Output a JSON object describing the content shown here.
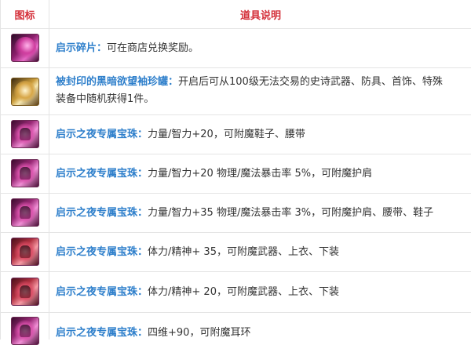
{
  "header": {
    "icon_col": "图标",
    "desc_col": "道具说明"
  },
  "rows": [
    {
      "icon": "shard-icon",
      "name": "启示碎片：",
      "text": "可在商店兑换奖励。"
    },
    {
      "icon": "jar-icon",
      "name": "被封印的黑暗欲望袖珍罐：",
      "text": "开启后可从100级无法交易的史诗武器、防具、首饰、特殊",
      "text2": "装备中随机获得1件。"
    },
    {
      "icon": "gem-icon",
      "name": "启示之夜专属宝珠：",
      "text": "力量/智力+20，可附魔鞋子、腰带"
    },
    {
      "icon": "gem-icon",
      "name": "启示之夜专属宝珠：",
      "text": "力量/智力+20 物理/魔法暴击率 5%，可附魔护肩"
    },
    {
      "icon": "gem-icon",
      "name": "启示之夜专属宝珠：",
      "text": "力量/智力+35 物理/魔法暴击率 3%，可附魔护肩、腰带、鞋子"
    },
    {
      "icon": "gem-icon",
      "name": "启示之夜专属宝珠：",
      "text": "体力/精神+ 35，可附魔武器、上衣、下装"
    },
    {
      "icon": "gem-icon",
      "name": "启示之夜专属宝珠：",
      "text": "体力/精神+ 20，可附魔武器、上衣、下装"
    },
    {
      "icon": "gem-icon",
      "name": "启示之夜专属宝珠：",
      "text": "四维+90，可附魔耳环"
    }
  ]
}
